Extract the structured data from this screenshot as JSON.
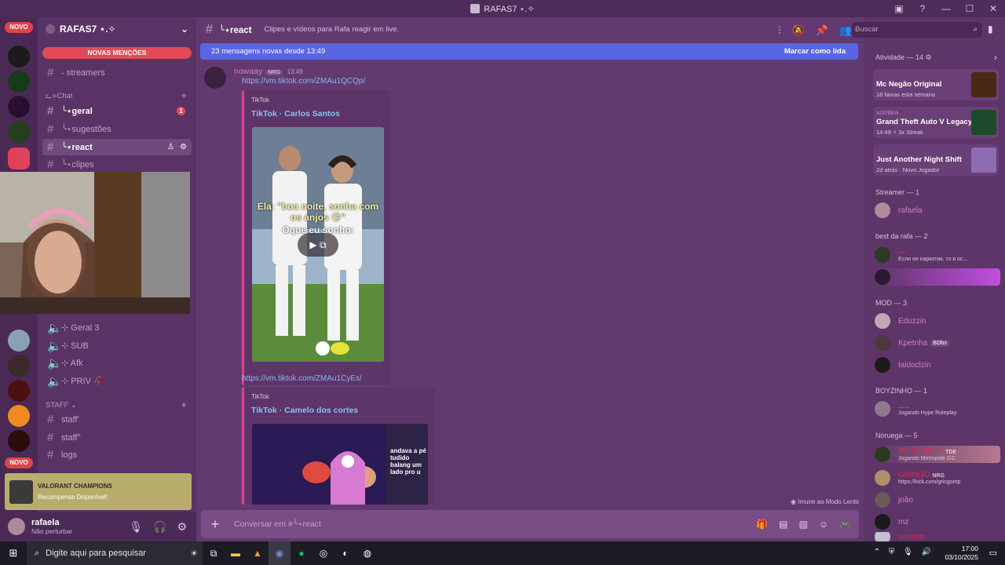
{
  "window": {
    "title": "RAFAS7 ⋆.✧"
  },
  "server": {
    "name": "RAFAS7 ⋆.✧",
    "mentions_label": "NOVAS MENÇÕES",
    "novo_label": "NOVO"
  },
  "channels": {
    "streamers": "˖ streamers",
    "chat_category": "ᓚ⟡Chat",
    "geral": "╰⋆geral",
    "geral_badge": "1",
    "sugestoes": "╰⋆sugestões",
    "react": "╰⋆react",
    "clipes": "╰⋆clipes",
    "geral3": "⊹ Geral 3",
    "sub": "⊹ SUB",
    "afk": "⊹ Afk",
    "priv": "⊹ PRIV 🥀",
    "staff_category": "STAFF",
    "staff1": "staff'",
    "staff2": "staff°",
    "logs": "logs"
  },
  "promo": {
    "brand": "VALORANT CHAMPIONS",
    "text": "Recompensa Disponível!"
  },
  "user": {
    "name": "rafaela",
    "status": "Não perturbar"
  },
  "header": {
    "channel": "╰⋆react",
    "topic": "Clipes e vídeos para Rafa reagir em live.",
    "search_placeholder": "Buscar"
  },
  "newbar": {
    "text": "23 mensagens novas desde 13:49",
    "mark": "Marcar como lida"
  },
  "message": {
    "author": "nowaay",
    "tag": "NRG",
    "time": "13:49",
    "link1": "https://vm.tiktok.com/ZMAu1QCQp/",
    "embed1": {
      "provider": "TikTok",
      "title": "TikTok · Carlos Santos",
      "caption1": "Ela: \"boa noite, sonha com os anjos 😘\"",
      "caption2": "Oque eu sonho:"
    },
    "link2": "https://vm.tiktok.com/ZMAu1CyEs/",
    "embed2": {
      "provider": "TikTok",
      "title": "TikTok · Camelo dos cortes",
      "caption": "andava a pé tudido balang um lado pro u"
    }
  },
  "composer": {
    "placeholder": "Conversar em #╰⋆react",
    "slowmode": "Imune ao Modo Lento"
  },
  "members": {
    "activity_header": "Atividade — 14",
    "activities": [
      {
        "title": "Mc Negão Original",
        "sub": "18 faixas esta semana",
        "user": ""
      },
      {
        "title": "Grand Theft Auto V Legacy",
        "sub": "14:49 ⚡ 3x Streak",
        "user": "sombra"
      },
      {
        "title": "Just Another Night Shift",
        "sub": "2d atrás · Novo Jogador",
        "user": ""
      }
    ],
    "streamer_header": "Streamer — 1",
    "streamer": "rafaela",
    "best_header": "best da rafa — 2",
    "best1_status": "Если он наркотик, то я ос...",
    "mod_header": "MOD — 3",
    "mods": [
      "Eduzzin",
      "Kpetnha",
      "taldoclzin"
    ],
    "mod_tag": "Bʘbs",
    "boy_header": "BOYZINHO — 1",
    "boy_status": "Jogando Hype Roleplay",
    "boy_name": ".....",
    "noruega_header": "Noruega — 5",
    "noruega": [
      {
        "name": "2B 1T 222 ⁴⁴",
        "tag": "TDE",
        "status": "Jogando Metropole GG"
      },
      {
        "name": "GRINGO",
        "tag": "NRG",
        "status": "https://kick.com/gringontp"
      },
      {
        "name": "joão",
        "tag": "",
        "status": ""
      },
      {
        "name": "mz",
        "tag": "",
        "status": ""
      },
      {
        "name": "sombra",
        "tag": "",
        "status": ""
      }
    ]
  },
  "taskbar": {
    "search": "Digite aqui para pesquisar",
    "time": "17:00",
    "date": "03/10/2025"
  }
}
